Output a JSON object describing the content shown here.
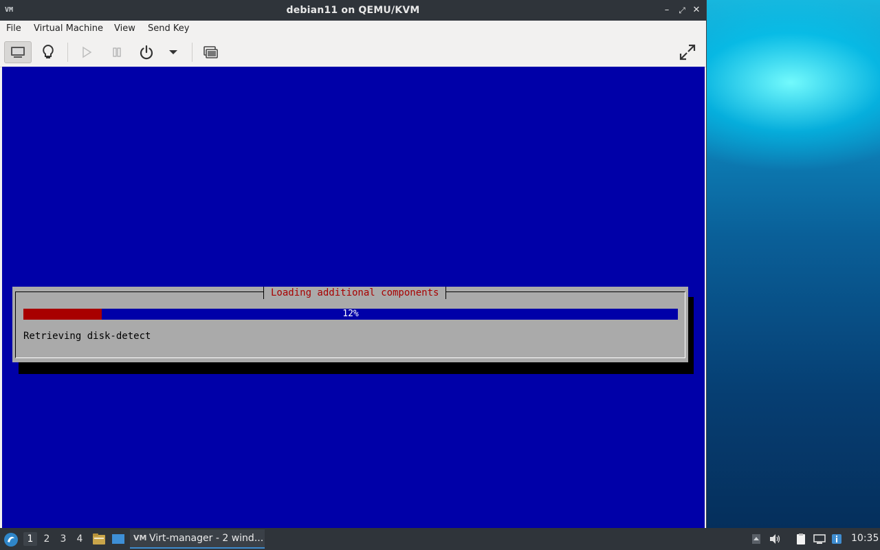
{
  "window": {
    "title": "debian11 on QEMU/KVM",
    "app_icon": "VM",
    "minimize": "–",
    "maximize": "⤢",
    "close": "✕"
  },
  "menu": {
    "items": [
      "File",
      "Virtual Machine",
      "View",
      "Send Key"
    ]
  },
  "toolbar": {
    "buttons": [
      "console-view",
      "details-view",
      "run",
      "pause",
      "power",
      "power-menu",
      "snapshots",
      "fullscreen"
    ]
  },
  "installer": {
    "dialog_title": "Loading additional components",
    "progress_percent": 12,
    "progress_label": "12%",
    "status": "Retrieving disk-detect"
  },
  "taskbar": {
    "desktops": [
      "1",
      "2",
      "3",
      "4"
    ],
    "active_desktop": "1",
    "task_label": "Virt-manager - 2 wind...",
    "clock": "10:35"
  },
  "colors": {
    "console_bg": "#0000a8",
    "progress_fill": "#a80000",
    "dialog_bg": "#aaaaaa",
    "titlebar": "#2f343a",
    "task_underline": "#3f8dd0"
  }
}
